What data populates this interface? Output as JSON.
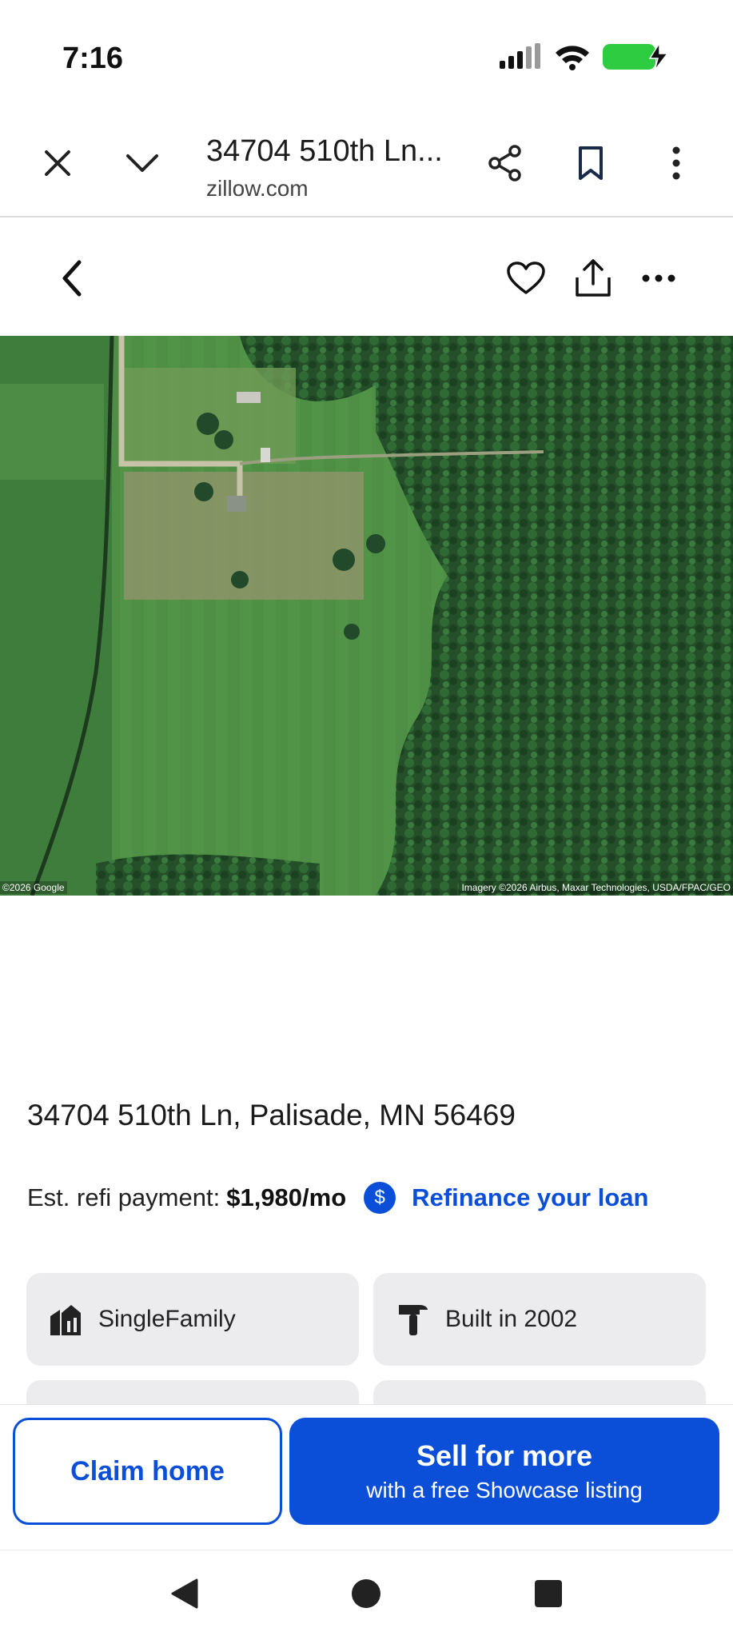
{
  "status_bar": {
    "time": "7:16",
    "icons": [
      "signal-icon",
      "wifi-icon",
      "battery-charging-icon"
    ],
    "battery_color": "#2ecc40"
  },
  "browser": {
    "title": "34704 510th Ln...",
    "domain": "zillow.com",
    "icons": [
      "close-icon",
      "chevron-down-icon",
      "share-icon",
      "bookmark-icon",
      "more-vertical-icon"
    ]
  },
  "header": {
    "icons": [
      "back-icon",
      "heart-icon",
      "upload-share-icon",
      "more-horizontal-icon"
    ]
  },
  "map": {
    "credit_left": "©2026 Google",
    "credit_right": "Imagery ©2026 Airbus, Maxar Technologies, USDA/FPAC/GEO"
  },
  "listing": {
    "address": "34704 510th Ln, Palisade, MN 56469",
    "refi_label": "Est. refi payment:",
    "refi_value": "$1,980/mo",
    "refi_link": "Refinance your loan",
    "refi_icon": "$",
    "facts": [
      {
        "label": "SingleFamily",
        "icon": "home-type-icon"
      },
      {
        "label": "Built in 2002",
        "icon": "hammer-icon"
      }
    ]
  },
  "actions": {
    "claim_label": "Claim home",
    "sell_title": "Sell for more",
    "sell_subtitle": "with a free Showcase listing"
  },
  "nav": {
    "icons": [
      "nav-back-icon",
      "nav-home-icon",
      "nav-recents-icon"
    ]
  },
  "colors": {
    "accent": "#0b4fd8",
    "card_bg": "#ececee"
  }
}
